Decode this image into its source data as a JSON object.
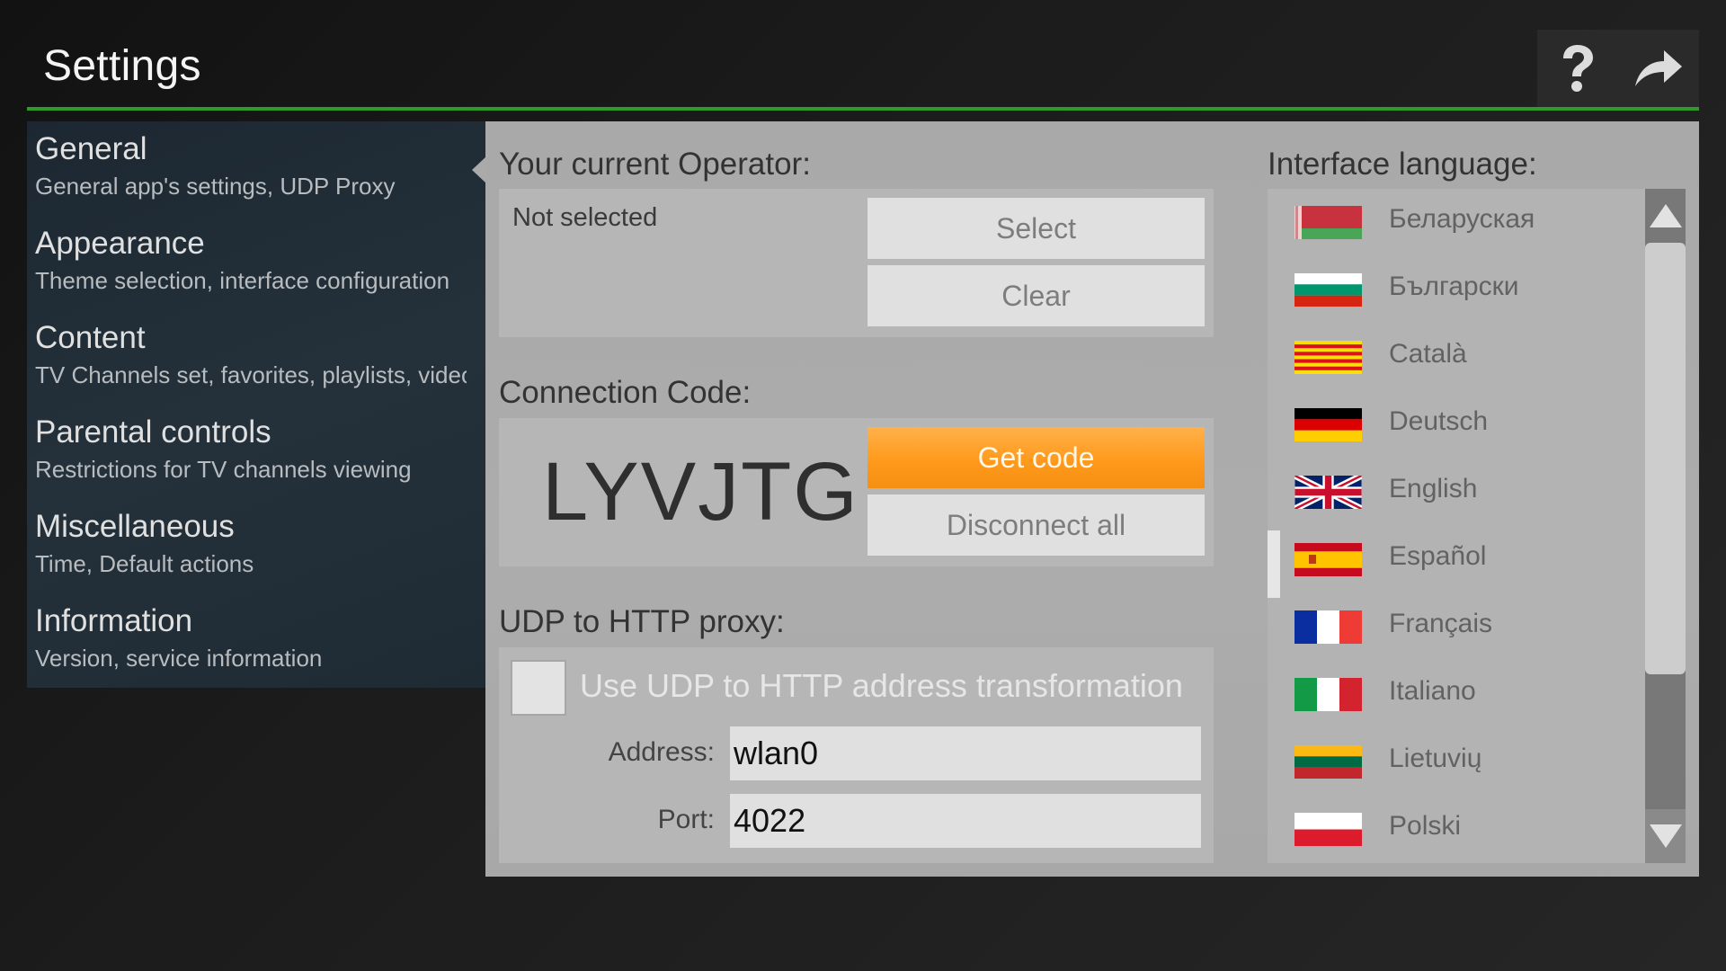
{
  "header": {
    "title": "Settings",
    "actions": [
      {
        "icon": "help-icon",
        "glyph": "?"
      },
      {
        "icon": "forward-arrow-icon",
        "glyph": "↪"
      }
    ]
  },
  "sidebar": {
    "selected": "General",
    "items": [
      {
        "title": "General",
        "subtitle": "General app's settings, UDP Proxy"
      },
      {
        "title": "Appearance",
        "subtitle": "Theme selection, interface configuration"
      },
      {
        "title": "Content",
        "subtitle": "TV Channels set, favorites, playlists, video"
      },
      {
        "title": "Parental controls",
        "subtitle": "Restrictions for TV channels viewing"
      },
      {
        "title": "Miscellaneous",
        "subtitle": "Time, Default actions"
      },
      {
        "title": "Information",
        "subtitle": "Version, service information"
      }
    ]
  },
  "operator": {
    "label": "Your current Operator:",
    "value": "Not selected",
    "select_label": "Select",
    "clear_label": "Clear"
  },
  "connection": {
    "label": "Connection Code:",
    "code": "LYVJTG",
    "get_code_label": "Get code",
    "disconnect_label": "Disconnect all"
  },
  "udp_proxy": {
    "label": "UDP to HTTP proxy:",
    "checkbox_label": "Use UDP to HTTP address transformation",
    "checked": false,
    "address_label": "Address:",
    "address_value": "wlan0",
    "port_label": "Port:",
    "port_value": "4022"
  },
  "language": {
    "label": "Interface language:",
    "selected": "English",
    "items": [
      {
        "name": "Беларуская",
        "flag": "by"
      },
      {
        "name": "Български",
        "flag": "bg"
      },
      {
        "name": "Català",
        "flag": "cat"
      },
      {
        "name": "Deutsch",
        "flag": "de"
      },
      {
        "name": "English",
        "flag": "gb"
      },
      {
        "name": "Español",
        "flag": "es"
      },
      {
        "name": "Français",
        "flag": "fr"
      },
      {
        "name": "Italiano",
        "flag": "it"
      },
      {
        "name": "Lietuvių",
        "flag": "lt"
      },
      {
        "name": "Polski",
        "flag": "pl"
      }
    ]
  },
  "colors": {
    "accent_green": "#2e9a2a",
    "primary_button": "#ff9a1c"
  }
}
